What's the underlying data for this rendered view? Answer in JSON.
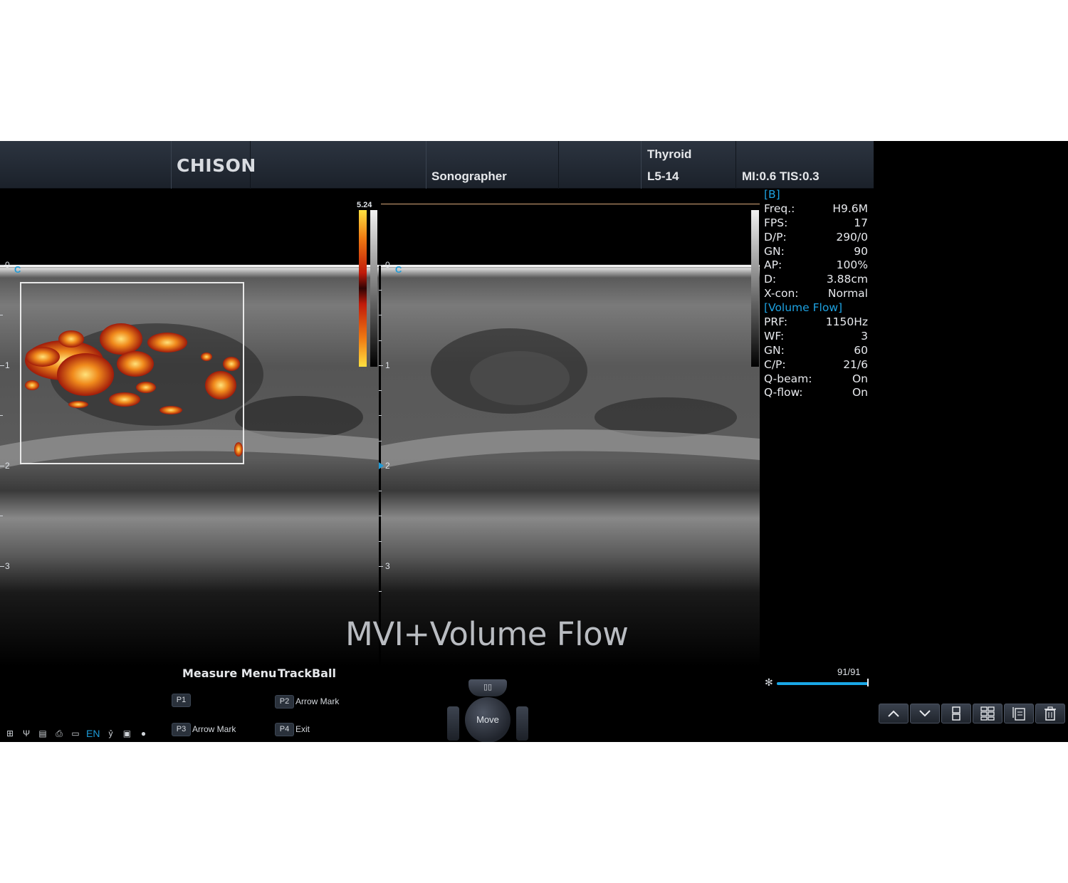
{
  "header": {
    "brand": "CHISON",
    "operator": "Sonographer",
    "exam": "Thyroid",
    "probe": "L5-14",
    "safety": "MI:0.6 TIS:0.3"
  },
  "colorbar": {
    "max_label": "5.24"
  },
  "scale": {
    "labels": [
      "0",
      "1",
      "2",
      "3"
    ]
  },
  "params": {
    "b_section": "[B]",
    "b": [
      {
        "k": "Freq.:",
        "v": "H9.6M"
      },
      {
        "k": "FPS:",
        "v": "17"
      },
      {
        "k": "D/P:",
        "v": "290/0"
      },
      {
        "k": "GN:",
        "v": "90"
      },
      {
        "k": "AP:",
        "v": "100%"
      },
      {
        "k": "D:",
        "v": "3.88cm"
      },
      {
        "k": "X-con:",
        "v": "Normal"
      }
    ],
    "vf_section": "[Volume Flow]",
    "vf": [
      {
        "k": "PRF:",
        "v": "1150Hz"
      },
      {
        "k": "WF:",
        "v": "3"
      },
      {
        "k": "GN:",
        "v": "60"
      },
      {
        "k": "C/P:",
        "v": "21/6"
      },
      {
        "k": "Q-beam:",
        "v": "On"
      },
      {
        "k": "Q-flow:",
        "v": "On"
      }
    ]
  },
  "overlay_title": "MVI+Volume Flow",
  "menu": {
    "measure": "Measure Menu",
    "trackball": "TrackBall",
    "p1": "P1",
    "p2": "P2",
    "p2_label": "Arrow Mark",
    "p3": "P3",
    "p3_label": "Arrow Mark",
    "p4": "P4",
    "p4_label": "Exit"
  },
  "status": {
    "lang": "EN"
  },
  "trackball": {
    "move": "Move"
  },
  "cine": {
    "counter": "91/91",
    "progress": 1.0
  },
  "toolbar": {
    "icons": [
      "chevron-up-icon",
      "chevron-down-icon",
      "dual-layout-icon",
      "quad-layout-icon",
      "report-icon",
      "trash-icon"
    ]
  }
}
